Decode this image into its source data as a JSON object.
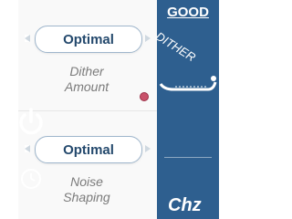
{
  "controls": [
    {
      "value": "Optimal",
      "label_line1": "Dither",
      "label_line2": "Amount"
    },
    {
      "value": "Optimal",
      "label_line1": "Noise",
      "label_line2": "Shaping"
    }
  ],
  "panel": {
    "title": "GOOD",
    "subtitle": "DITHER",
    "bottom_text": "Chz"
  },
  "colors": {
    "panel_bg": "#2e5f8f",
    "value_text": "#24496d",
    "indicator": "#c9526b"
  },
  "icons": [
    "power-icon",
    "clock-icon",
    "dither-slider-icon",
    "left-arrow-icon",
    "right-arrow-icon"
  ]
}
